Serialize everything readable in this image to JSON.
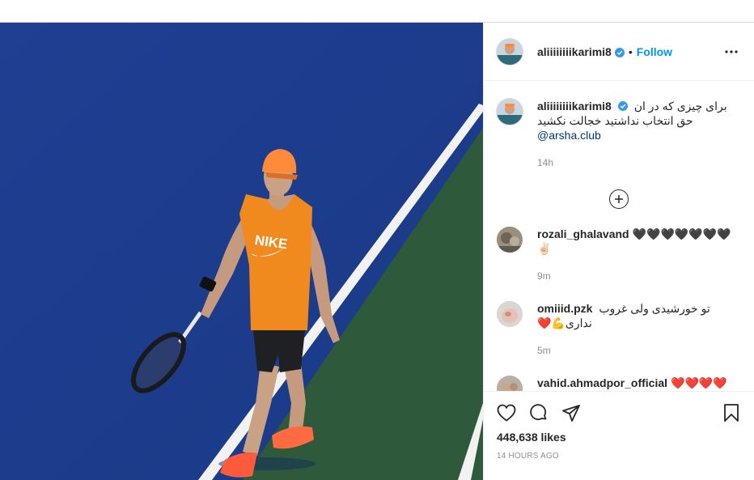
{
  "post": {
    "author": "aliiiiiiiikarimi8",
    "follow_label": "Follow",
    "dot": "•",
    "caption_line1": "برای چیزی که در ان",
    "caption_line2": "حق انتخاب نداشتید خجالت نکشید",
    "mention": "@arsha.club",
    "caption_time": "14h",
    "likes": "448,638 likes",
    "time_ago": "14 HOURS AGO",
    "media_text": "NIKE"
  },
  "comments": [
    {
      "user": "rozali_ghalavand",
      "text": "🖤🖤🖤🖤🖤🖤🖤✌🏻",
      "time": "9m"
    },
    {
      "user": "omiiid.pzk",
      "text_line1": "تو خورشیدی ولی غروب",
      "text_line2": "نداری💪❤️",
      "time": "5m"
    },
    {
      "user": "vahid.ahmadpor_official",
      "text": "❤️❤️❤️❤️"
    }
  ],
  "icons": {
    "more": "more-options-icon",
    "verified": "verified-badge-icon",
    "load_more": "plus-circle-icon",
    "like": "heart-icon",
    "comment": "comment-icon",
    "share": "paper-plane-icon",
    "save": "bookmark-icon"
  },
  "colors": {
    "accent": "#0095f6",
    "court_blue": "#1d3f8f",
    "court_green": "#2f5a3c",
    "shirt": "#f08a1e"
  }
}
